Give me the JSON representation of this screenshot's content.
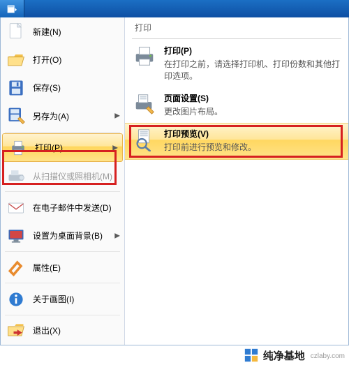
{
  "panel": {
    "title": "打印"
  },
  "left": {
    "new": "新建(N)",
    "open": "打开(O)",
    "save": "保存(S)",
    "saveas": "另存为(A)",
    "print": "打印(P)",
    "scanner": "从扫描仪或照相机(M)",
    "email": "在电子邮件中发送(D)",
    "wallpaper": "设置为桌面背景(B)",
    "properties": "属性(E)",
    "about": "关于画图(I)",
    "exit": "退出(X)"
  },
  "right": {
    "print": {
      "title": "打印(P)",
      "desc": "在打印之前，请选择打印机、打印份数和其他打印选项。"
    },
    "page": {
      "title": "页面设置(S)",
      "desc": "更改图片布局。"
    },
    "preview": {
      "title": "打印预览(V)",
      "desc": "打印前进行预览和修改。"
    }
  },
  "footer": {
    "brand": "纯净基地",
    "url": "czlaby.com"
  }
}
